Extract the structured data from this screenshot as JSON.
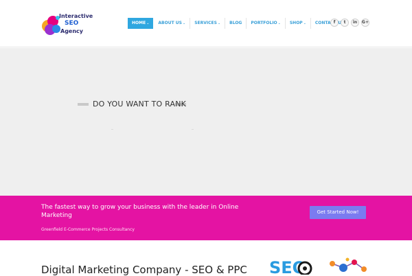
{
  "brand": {
    "logo_line1": "Interactive",
    "logo_line2": "SEO",
    "logo_line3": "Agency"
  },
  "nav": {
    "items": [
      {
        "label": "HOME",
        "active": true,
        "dropdown": true
      },
      {
        "label": "ABOUT US",
        "active": false,
        "dropdown": true
      },
      {
        "label": "SERVICES",
        "active": false,
        "dropdown": true
      },
      {
        "label": "BLOG",
        "active": false,
        "dropdown": false
      },
      {
        "label": "PORTFOLIO",
        "active": false,
        "dropdown": true
      },
      {
        "label": "SHOP",
        "active": false,
        "dropdown": true
      },
      {
        "label": "CONTACT US",
        "active": false,
        "dropdown": false
      }
    ],
    "caret": "⌄"
  },
  "social": {
    "facebook": "f",
    "twitter": "t",
    "linkedin": "in",
    "googleplus": "G+"
  },
  "hero": {
    "title": "DO YOU WANT TO RANK"
  },
  "banner": {
    "title": "The fastest way to grow your business with the leader in Online Marketing",
    "subtitle": "Greenfield E-Commerce Projects Consultancy",
    "cta_label": "Get Started Now!"
  },
  "content": {
    "title": "Digital Marketing Company - SEO & PPC",
    "seo_image_text": "SEO"
  },
  "colors": {
    "nav_accent": "#2fa7e0",
    "banner_bg": "#e413a3",
    "cta_bg": "#7b7bf0",
    "hero_bg": "#efefef"
  }
}
